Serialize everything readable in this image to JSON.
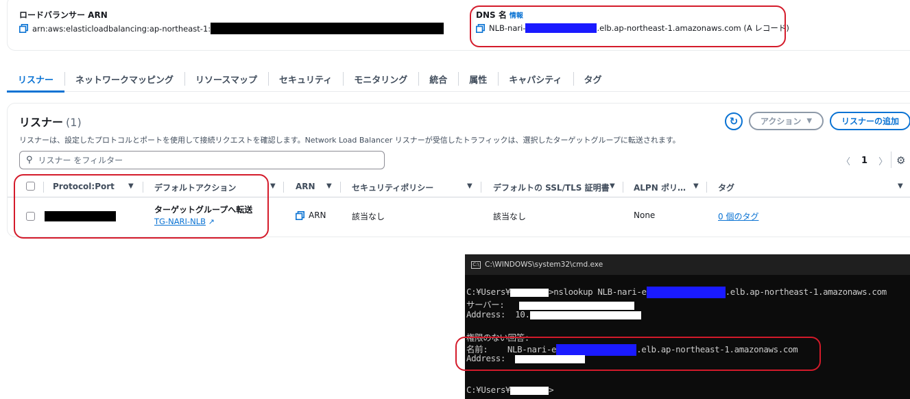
{
  "details": {
    "arn_label": "ロードバランサー ARN",
    "arn_value": "arn:aws:elasticloadbalancing:ap-northeast-1:",
    "dns_label": "DNS 名",
    "dns_info": "情報",
    "dns_prefix": "NLB-nari-",
    "dns_suffix": ".elb.ap-northeast-1.amazonaws.com (A レコード)"
  },
  "tabs": [
    {
      "label": "リスナー",
      "active": true
    },
    {
      "label": "ネットワークマッピング"
    },
    {
      "label": "リソースマップ"
    },
    {
      "label": "セキュリティ"
    },
    {
      "label": "モニタリング"
    },
    {
      "label": "統合"
    },
    {
      "label": "属性"
    },
    {
      "label": "キャパシティ"
    },
    {
      "label": "タグ"
    }
  ],
  "listeners": {
    "title": "リスナー",
    "count": "(1)",
    "description": "リスナーは、設定したプロトコルとポートを使用して接続リクエストを確認します。Network Load Balancer リスナーが受信したトラフィックは、選択したターゲットグループに転送されます。",
    "action_button": "アクション",
    "add_button": "リスナーの追加",
    "filter_placeholder": "リスナー をフィルター",
    "page": "1",
    "columns": [
      "Protocol:Port",
      "デフォルトアクション",
      "ARN",
      "セキュリティポリシー",
      "デフォルトの SSL/TLS 証明書",
      "ALPN ポリ…",
      "タグ"
    ],
    "row": {
      "action_title": "ターゲットグループへ転送",
      "action_link": "TG-NARI-NLB",
      "arn": "ARN",
      "security_policy": "該当なし",
      "ssl_cert": "該当なし",
      "alpn": "None",
      "tags": "0 個のタグ"
    }
  },
  "cmd": {
    "title": "C:\\WINDOWS\\system32\\cmd.exe",
    "prompt_prefix": "C:¥Users¥",
    "command_mid": ">nslookup NLB-nari-e",
    "command_end": ".elb.ap-northeast-1.amazonaws.com",
    "server_label": "サーバー:",
    "address_label": "Address:",
    "address_prefix": "10.",
    "nonauth": "権限のない回答:",
    "name_label": "名前:",
    "name_prefix": "NLB-nari-e",
    "name_suffix": ".elb.ap-northeast-1.amazonaws.com",
    "address2_label": "Address:",
    "final_prompt_end": ">"
  }
}
